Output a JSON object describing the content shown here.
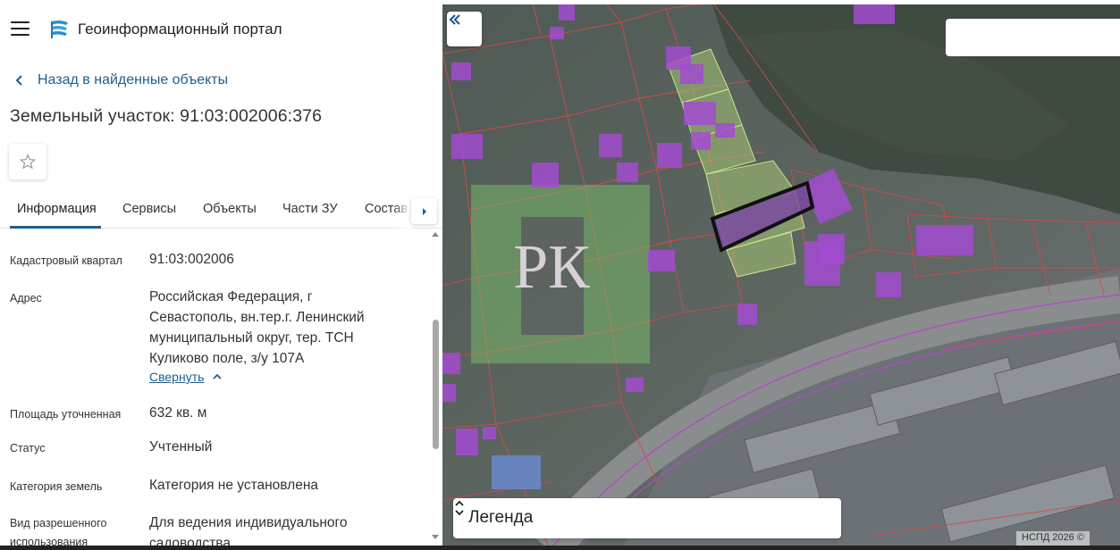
{
  "header": {
    "portal_title": "Геоинформационный портал",
    "menu_icon": "hamburger-menu-icon",
    "logo_icon": "portal-logo-icon"
  },
  "back_link": {
    "label": "Назад в найденные объекты"
  },
  "object": {
    "title": "Земельный участок: 91:03:002006:376"
  },
  "favorite_icon": "star-outline-icon",
  "tabs": [
    {
      "label": "Информация",
      "active": true
    },
    {
      "label": "Сервисы"
    },
    {
      "label": "Объекты"
    },
    {
      "label": "Части ЗУ"
    },
    {
      "label": "Состав"
    }
  ],
  "properties": {
    "cadastral_quarter": {
      "label": "Кадастровый квартал",
      "value": "91:03:002006"
    },
    "address": {
      "label": "Адрес",
      "value_lines": [
        "Российская Федерация, г",
        "Севастополь, вн.тер.г. Ленинский",
        "муниципальный округ, тер. ТСН",
        "Куликово поле, з/у 107А"
      ],
      "collapse_label": "Свернуть"
    },
    "area": {
      "label": "Площадь уточненная",
      "value": "632 кв. м"
    },
    "status": {
      "label": "Статус",
      "value": "Учтенный"
    },
    "land_category": {
      "label": "Категория земель",
      "value": "Категория не установлена"
    },
    "permitted_use": {
      "label_lines": [
        "Вид разрешенного",
        "использования"
      ],
      "value_lines": [
        "Для ведения индивидуального",
        "садоводства"
      ]
    }
  },
  "map": {
    "legend_label": "Легенда",
    "copyright": "НСПД 2026 ©",
    "search_placeholder": "",
    "watermark_text": "РК",
    "colors": {
      "parcel_border": "#d24a4a",
      "building_fill": "#a24bd0",
      "highlight_fill": "#b6dc7c",
      "selected_border": "#111111",
      "accent": "#1f5f8b"
    }
  }
}
